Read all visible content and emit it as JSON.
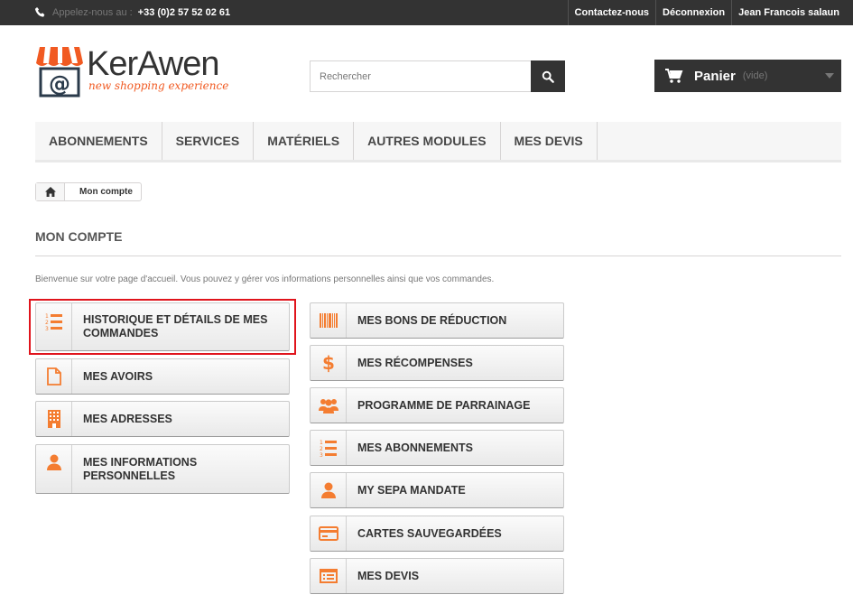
{
  "topbar": {
    "phone_label": "Appelez-nous au :",
    "phone_number": "+33 (0)2 57 52 02 61",
    "links": [
      "Contactez-nous",
      "Déconnexion",
      "Jean Francois salaun"
    ]
  },
  "logo": {
    "brand": "KerAwen",
    "tagline": "new shopping experience",
    "accent_color": "#f15a22"
  },
  "search": {
    "placeholder": "Rechercher",
    "value": ""
  },
  "cart": {
    "label": "Panier",
    "status": "(vide)"
  },
  "nav": [
    "ABONNEMENTS",
    "SERVICES",
    "MATÉRIELS",
    "AUTRES MODULES",
    "MES DEVIS"
  ],
  "breadcrumb": {
    "current": "Mon compte"
  },
  "page": {
    "title": "MON COMPTE",
    "intro": "Bienvenue sur votre page d'accueil. Vous pouvez y gérer vos informations personnelles ainsi que vos commandes."
  },
  "account": {
    "left": [
      {
        "label": "HISTORIQUE ET DÉTAILS DE MES COMMANDES",
        "icon": "list-ordered-icon"
      },
      {
        "label": "MES AVOIRS",
        "icon": "file-icon"
      },
      {
        "label": "MES ADRESSES",
        "icon": "building-icon"
      },
      {
        "label": "MES INFORMATIONS PERSONNELLES",
        "icon": "user-icon"
      }
    ],
    "right": [
      {
        "label": "MES BONS DE RÉDUCTION",
        "icon": "barcode-icon"
      },
      {
        "label": "MES RÉCOMPENSES",
        "icon": "dollar-icon"
      },
      {
        "label": "PROGRAMME DE PARRAINAGE",
        "icon": "group-icon"
      },
      {
        "label": "MES ABONNEMENTS",
        "icon": "list-ordered-icon"
      },
      {
        "label": "MY SEPA MANDATE",
        "icon": "user-icon"
      },
      {
        "label": "CARTES SAUVEGARDÉES",
        "icon": "credit-card-icon"
      },
      {
        "label": "MES DEVIS",
        "icon": "list-alt-icon"
      }
    ]
  },
  "colors": {
    "icon": "#f47d31",
    "highlight": "#e0141c",
    "topbar": "#333333"
  }
}
